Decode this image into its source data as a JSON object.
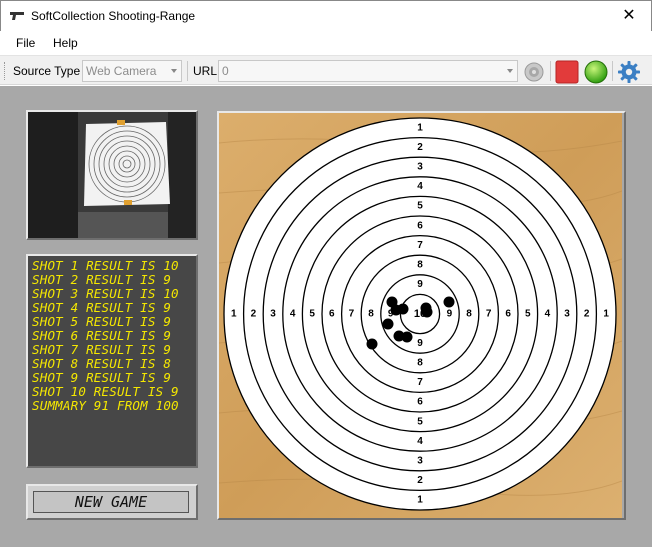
{
  "window": {
    "title": "SoftCollection Shooting-Range",
    "close_glyph": "✕"
  },
  "menu": {
    "items": [
      "File",
      "Help"
    ]
  },
  "toolbar": {
    "source_type_label": "Source Type",
    "source_type_value": "Web Camera",
    "url_label": "URL",
    "url_value": "0",
    "connect_icon": "camera-connect-icon",
    "stop_icon": "stop-red-square-icon",
    "start_icon": "go-green-circle-icon",
    "settings_icon": "gear-icon"
  },
  "log": {
    "lines": [
      "SHOT 1 RESULT IS 10",
      "SHOT 2 RESULT IS 9",
      "SHOT 3 RESULT IS 10",
      "SHOT 4 RESULT IS 9",
      "SHOT 5 RESULT IS 9",
      "SHOT 6 RESULT IS 9",
      "SHOT 7 RESULT IS 9",
      "SHOT 8 RESULT IS 8",
      "SHOT 9 RESULT IS 9",
      "SHOT 10 RESULT IS 9",
      "SUMMARY 91 FROM 100"
    ]
  },
  "new_game_label": "NEW GAME",
  "target": {
    "ring_numbers": [
      "1",
      "2",
      "3",
      "4",
      "5",
      "6",
      "7",
      "8",
      "9",
      "10"
    ],
    "colors": {
      "ring_fill": "#ffffff",
      "ring_stroke": "#000000",
      "wood": "#d6a866",
      "hole": "#000000",
      "log_text": "#f5e800",
      "stop": "#e23b3b",
      "go": "#3fbf1f"
    }
  }
}
